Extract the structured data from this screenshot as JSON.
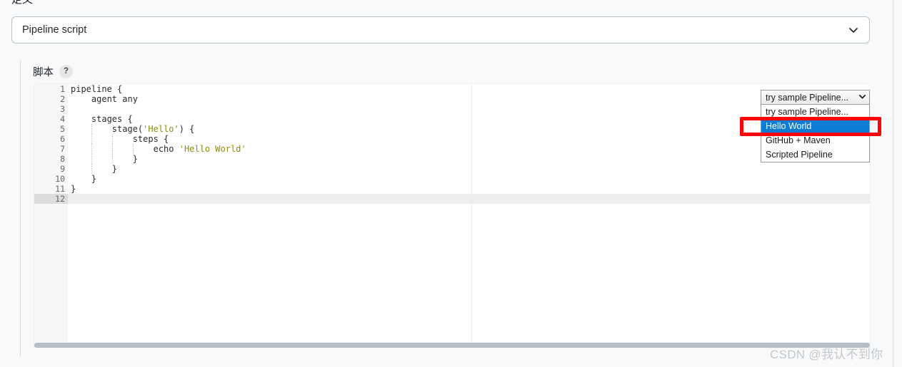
{
  "page": {
    "section_heading": "定义"
  },
  "definition": {
    "selected": "Pipeline script",
    "chevron_icon": "chevron-down-icon"
  },
  "script_field": {
    "label": "脚本",
    "help_icon_label": "?"
  },
  "editor": {
    "gutter": [
      {
        "num": "1",
        "fold": "▾"
      },
      {
        "num": "2",
        "fold": ""
      },
      {
        "num": "3",
        "fold": ""
      },
      {
        "num": "4",
        "fold": "▾"
      },
      {
        "num": "5",
        "fold": "▾"
      },
      {
        "num": "6",
        "fold": "▾"
      },
      {
        "num": "7",
        "fold": ""
      },
      {
        "num": "8",
        "fold": ""
      },
      {
        "num": "9",
        "fold": ""
      },
      {
        "num": "10",
        "fold": ""
      },
      {
        "num": "11",
        "fold": ""
      },
      {
        "num": "12",
        "fold": ""
      }
    ],
    "lines": [
      "pipeline {",
      "    agent any",
      "",
      "    stages {",
      "        stage('Hello') {",
      "            steps {",
      "                echo 'Hello World'",
      "            }",
      "        }",
      "    }",
      "}",
      ""
    ],
    "active_line": 12,
    "scrollbar_name": "horizontal-scrollbar"
  },
  "sample_dropdown": {
    "selected_label": "try sample Pipeline...",
    "chevron_icon": "chevron-down-icon",
    "options": [
      {
        "label": "try sample Pipeline...",
        "selected": false
      },
      {
        "label": "Hello World",
        "selected": true
      },
      {
        "label": "GitHub + Maven",
        "selected": false
      },
      {
        "label": "Scripted Pipeline",
        "selected": false
      }
    ]
  },
  "annotation": {
    "color": "#fb0606",
    "target": "Hello World"
  },
  "watermark": {
    "text": "CSDN @我认不到你"
  },
  "colors": {
    "highlight_blue": "#0c7cd5",
    "annotation_red": "#fb0606",
    "string_olive": "#8c8c0a",
    "page_bg": "#f8f9fa"
  }
}
